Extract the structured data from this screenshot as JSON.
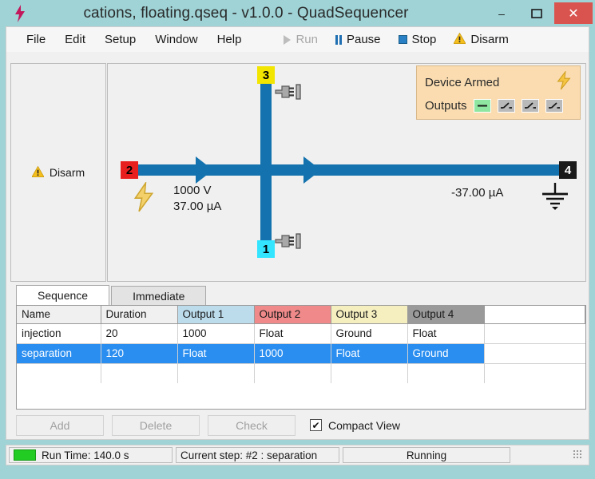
{
  "window": {
    "title": "cations, floating.qseq - v1.0.0 - QuadSequencer",
    "app_icon": "lightning-bolt-icon",
    "titlebar_color": "#9fd3d6",
    "minimize_label": "–",
    "maximize_label": "❑",
    "close_label": "✕",
    "close_color": "#d9534f"
  },
  "menubar": {
    "items": [
      {
        "label": "File"
      },
      {
        "label": "Edit"
      },
      {
        "label": "Setup"
      },
      {
        "label": "Window"
      },
      {
        "label": "Help"
      }
    ],
    "tools": [
      {
        "label": "Run",
        "icon": "play-icon",
        "enabled": false
      },
      {
        "label": "Pause",
        "icon": "pause-icon",
        "enabled": true
      },
      {
        "label": "Stop",
        "icon": "stop-icon",
        "enabled": true
      },
      {
        "label": "Disarm",
        "icon": "warning-icon",
        "enabled": true
      }
    ]
  },
  "side_panel": {
    "disarm_label": "Disarm",
    "disarm_icon": "warning-icon"
  },
  "diagram": {
    "channels": [
      {
        "id": "1",
        "label": "1",
        "bg": "#33e5ff",
        "fg": "#000000"
      },
      {
        "id": "2",
        "label": "2",
        "bg": "#e81f1f",
        "fg": "#000000"
      },
      {
        "id": "3",
        "label": "3",
        "bg": "#f2e500",
        "fg": "#000000"
      },
      {
        "id": "4",
        "label": "4",
        "bg": "#1a1a1a",
        "fg": "#ffffff"
      }
    ],
    "wire_color": "#1473ae",
    "labels": {
      "ch2_voltage": "1000 V",
      "ch2_current": "37.00 µA",
      "ch4_current": "-37.00 µA"
    },
    "icons": {
      "ch2_power": "lightning-bolt-icon",
      "ch4_ground": "ground-icon",
      "ch3_plug": "unplugged-icon",
      "ch1_plug": "unplugged-icon"
    }
  },
  "armed_panel": {
    "status_label": "Device Armed",
    "status_icon": "lightning-bolt-icon",
    "outputs_label": "Outputs",
    "background": "#fadcb0",
    "indicators": [
      {
        "state": "on",
        "icon": "connected-line-icon"
      },
      {
        "state": "off",
        "icon": "break-line-icon"
      },
      {
        "state": "off",
        "icon": "break-line-icon"
      },
      {
        "state": "off",
        "icon": "break-line-icon"
      }
    ]
  },
  "tabs": [
    {
      "label": "Sequence",
      "active": true
    },
    {
      "label": "Immediate",
      "active": false
    }
  ],
  "table": {
    "columns": [
      {
        "label": "Name",
        "color": "#f0f0f0"
      },
      {
        "label": "Duration",
        "color": "#f0f0f0"
      },
      {
        "label": "Output 1",
        "color": "#bcdcec"
      },
      {
        "label": "Output 2",
        "color": "#f08a8a"
      },
      {
        "label": "Output 3",
        "color": "#f5efc0"
      },
      {
        "label": "Output 4",
        "color": "#9a9a9a"
      }
    ],
    "rows": [
      {
        "selected": false,
        "name": "injection",
        "duration": "20",
        "output1": "1000",
        "output2": "Float",
        "output3": "Ground",
        "output4": "Float"
      },
      {
        "selected": true,
        "name": "separation",
        "duration": "120",
        "output1": "Float",
        "output2": "1000",
        "output3": "Float",
        "output4": "Ground"
      }
    ],
    "selection_color": "#2a8ef0"
  },
  "buttons": {
    "add": "Add",
    "delete": "Delete",
    "check": "Check",
    "compact_view": "Compact View",
    "compact_view_checked": true,
    "check_glyph": "✔"
  },
  "statusbar": {
    "run_time": "Run Time: 140.0 s",
    "current_step": "Current step: #2 : separation",
    "state": "Running",
    "led_color": "#22cc22"
  }
}
